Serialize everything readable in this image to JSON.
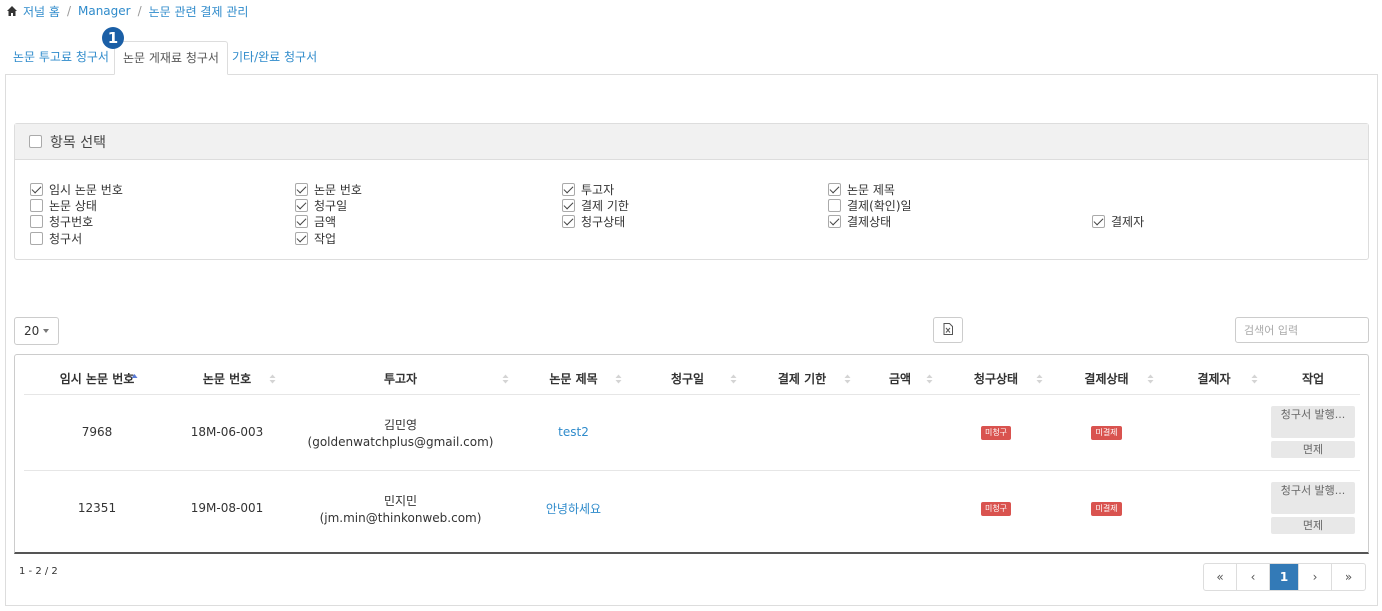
{
  "breadcrumb": {
    "home": "저널 홈",
    "manager": "Manager",
    "current": "논문 관련 결제 관리"
  },
  "tabs": [
    {
      "label": "논문 투고료 청구서"
    },
    {
      "label": "논문 게재료 청구서",
      "active": true
    },
    {
      "label": "기타/완료 청구서"
    }
  ],
  "callout_number": "1",
  "column_selector": {
    "header": "항목 선택",
    "options": [
      {
        "label": "임시 논문 번호",
        "checked": true
      },
      {
        "label": "논문 번호",
        "checked": true
      },
      {
        "label": "투고자",
        "checked": true
      },
      {
        "label": "논문 제목",
        "checked": true
      },
      {
        "label": "논문 상태",
        "checked": false
      },
      {
        "label": "청구일",
        "checked": true
      },
      {
        "label": "결제 기한",
        "checked": true
      },
      {
        "label": "결제(확인)일",
        "checked": false
      },
      {
        "label": "청구번호",
        "checked": false
      },
      {
        "label": "금액",
        "checked": true
      },
      {
        "label": "청구상태",
        "checked": true
      },
      {
        "label": "결제상태",
        "checked": true
      },
      {
        "label": "결제자",
        "checked": true
      },
      {
        "label": "청구서",
        "checked": false
      },
      {
        "label": "작업",
        "checked": true
      }
    ]
  },
  "toolbar": {
    "page_size": "20",
    "search_placeholder": "검색어 입력",
    "export_icon": "excel-file-icon"
  },
  "table": {
    "columns": [
      "임시 논문 번호",
      "논문 번호",
      "투고자",
      "논문 제목",
      "청구일",
      "결제 기한",
      "금액",
      "청구상태",
      "결제상태",
      "결제자",
      "작업"
    ],
    "rows": [
      {
        "temp_no": "7968",
        "paper_no": "18M-06-003",
        "author_name": "김민영",
        "author_email": "(goldenwatchplus@gmail.com)",
        "title": "test2",
        "billing_date": "",
        "due_date": "",
        "amount": "",
        "billing_status": "미청구",
        "payment_status": "미결제",
        "payer": "",
        "issue_btn": "청구서 발행...",
        "waive_btn": "면제"
      },
      {
        "temp_no": "12351",
        "paper_no": "19M-08-001",
        "author_name": "민지민",
        "author_email": "(jm.min@thinkonweb.com)",
        "title": "안녕하세요",
        "billing_date": "",
        "due_date": "",
        "amount": "",
        "billing_status": "미청구",
        "payment_status": "미결제",
        "payer": "",
        "issue_btn": "청구서 발행...",
        "waive_btn": "면제"
      }
    ]
  },
  "footer": {
    "summary": "1 - 2 / 2",
    "pager": {
      "first": "«",
      "prev": "‹",
      "current": "1",
      "next": "›",
      "last": "»"
    }
  },
  "colors": {
    "link": "#2f8bcb",
    "badge_red": "#d9534f",
    "pager_active": "#337ab7",
    "callout": "#1b5fa6"
  }
}
